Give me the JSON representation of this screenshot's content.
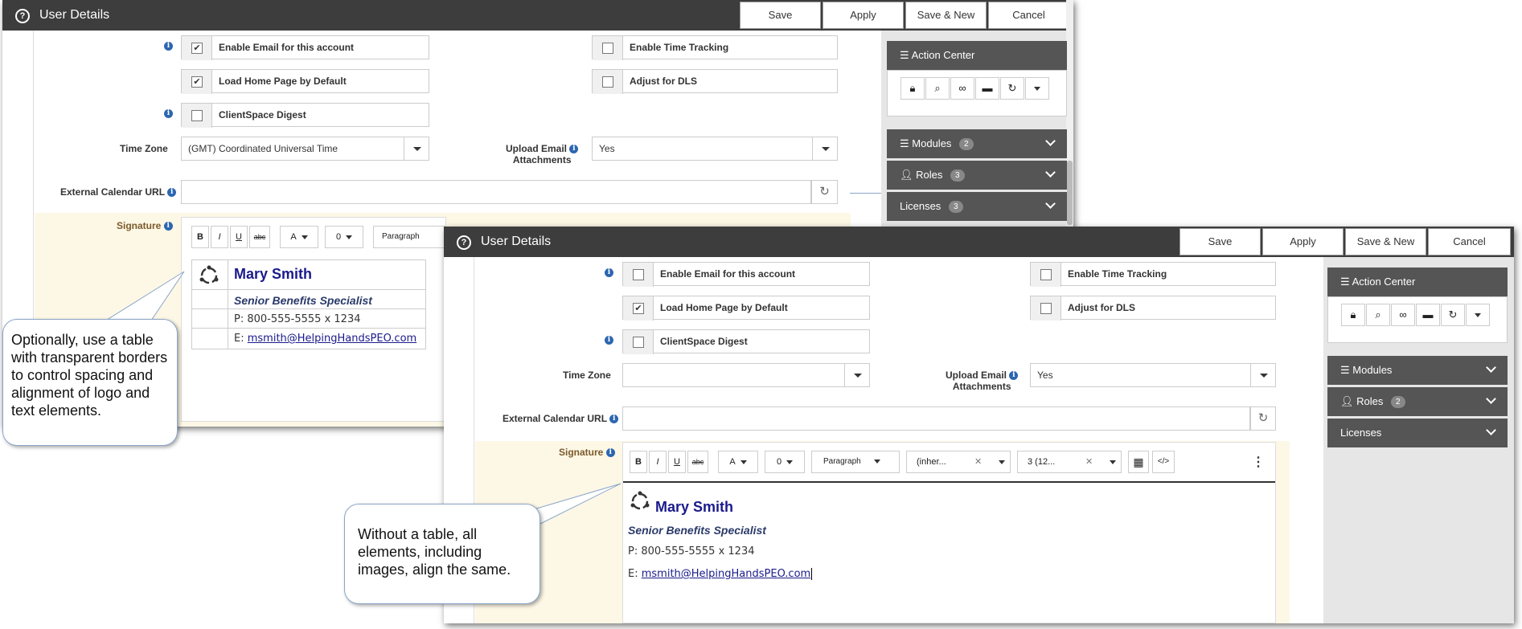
{
  "window": {
    "title": "User Details",
    "buttons": {
      "save": "Save",
      "apply": "Apply",
      "save_new": "Save & New",
      "cancel": "Cancel"
    }
  },
  "form": {
    "enable_email": "Enable Email for this account",
    "load_home": "Load Home Page by Default",
    "digest": "ClientSpace Digest",
    "time_tracking": "Enable Time Tracking",
    "adjust_dls": "Adjust for DLS",
    "time_zone_label": "Time Zone",
    "time_zone_value_back": "(GMT) Coordinated Universal Time",
    "time_zone_value_front": "",
    "upload_label_1": "Upload Email",
    "upload_label_2": "Attachments",
    "upload_value": "Yes",
    "ext_cal_label": "External Calendar URL",
    "signature_label": "Signature"
  },
  "toolbar": {
    "bold": "B",
    "italic": "I",
    "underline": "U",
    "strike": "abc",
    "font_color": "A",
    "highlight": "0",
    "paragraph": "Paragraph",
    "font_family": "(inher...",
    "font_size": "3 (12...",
    "code": "</>",
    "more": "⋮"
  },
  "signature": {
    "name": "Mary Smith",
    "title": "Senior Benefits Specialist",
    "phone": "P: 800-555-5555 x 1234",
    "email_prefix": "E: ",
    "email": "msmith@HelpingHandsPEO.com"
  },
  "sidebar": {
    "action_center": "Action Center",
    "modules": "Modules",
    "roles": "Roles",
    "licenses": "Licenses",
    "back_modules_count": "2",
    "back_roles_count": "3",
    "back_licenses_count": "3",
    "front_roles_count": "2"
  },
  "callouts": {
    "table": "Optionally, use a table with transparent borders to control spacing and alignment of logo and text elements.",
    "no_table": "Without a table, all elements, including images, align the same."
  }
}
